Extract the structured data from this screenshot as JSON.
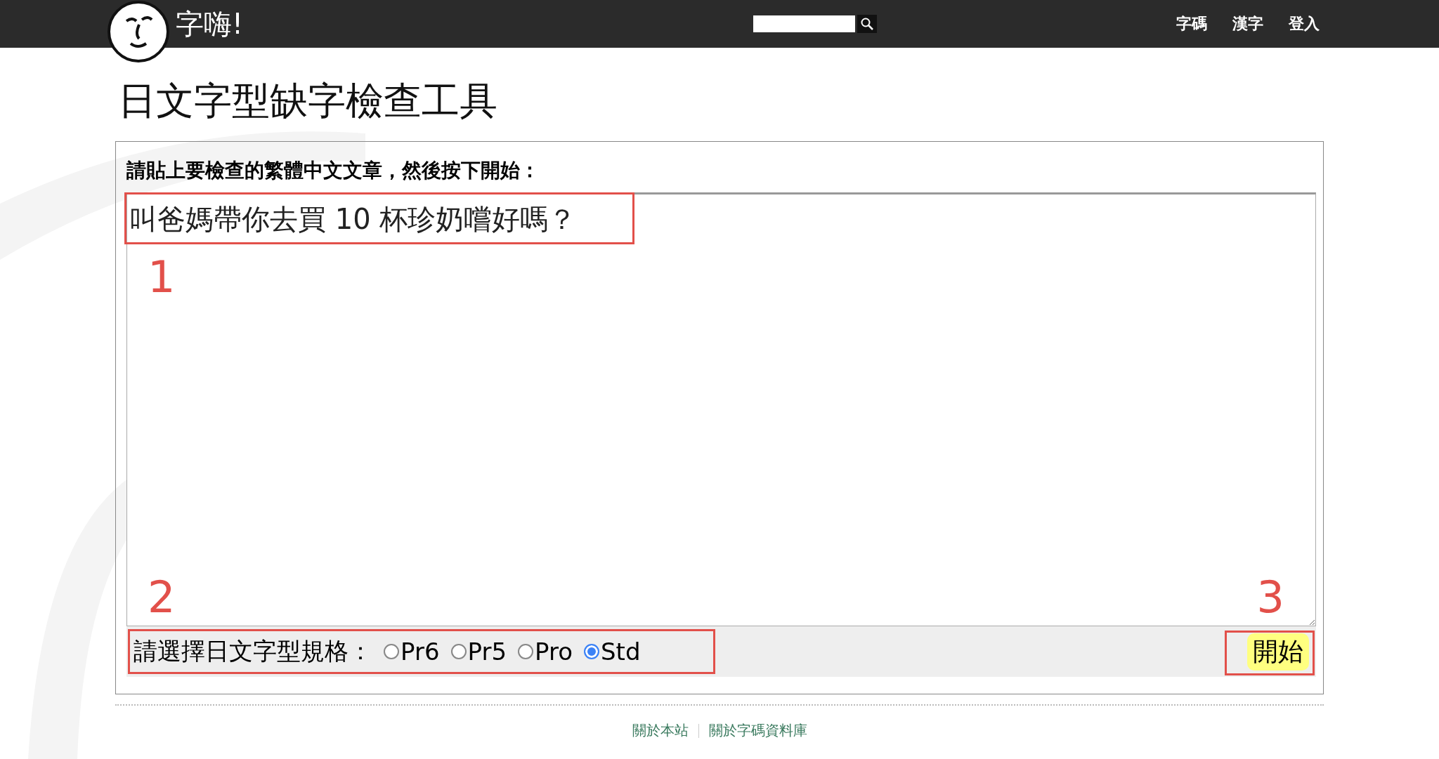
{
  "header": {
    "brand": "字嗨!",
    "nav": [
      "字碼",
      "漢字",
      "登入"
    ]
  },
  "title": "日文字型缺字檢查工具",
  "form": {
    "prompt": "請貼上要檢查的繁體中文文章，然後按下開始：",
    "text": "叫爸媽帶你去買 10 杯珍奶嚐好嗎？",
    "spec_label": "請選擇日文字型規格：",
    "options": [
      {
        "label": "Pr6",
        "selected": false
      },
      {
        "label": "Pr5",
        "selected": false
      },
      {
        "label": "Pro",
        "selected": false
      },
      {
        "label": "Std",
        "selected": true
      }
    ],
    "start_button": "開始"
  },
  "annotations": [
    "1",
    "2",
    "3"
  ],
  "footer": {
    "links": [
      "關於本站",
      "關於字碼資料庫"
    ]
  }
}
